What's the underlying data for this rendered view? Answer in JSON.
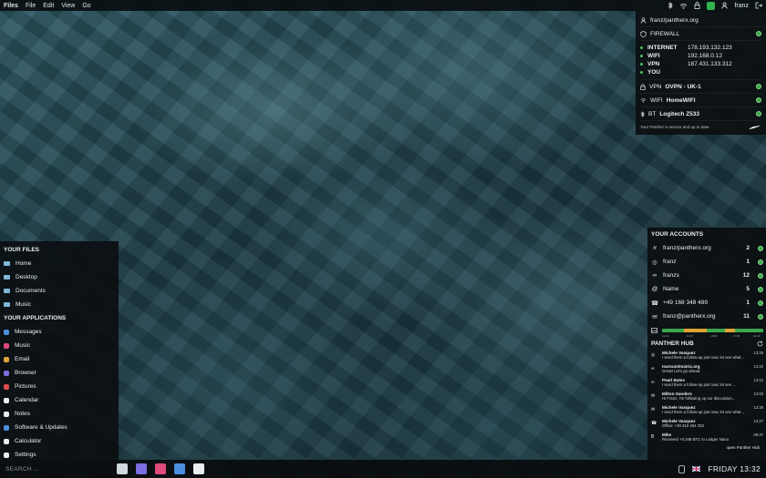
{
  "topbar": {
    "app_name": "Files",
    "menu": [
      "File",
      "Edit",
      "View",
      "Go"
    ],
    "user": "franz",
    "icons": [
      "bluetooth-icon",
      "wifi-icon",
      "lock-icon",
      "shield-badge-icon",
      "user-icon",
      "logout-icon"
    ]
  },
  "network": {
    "account": "franz/pantherx.org",
    "firewall_label": "FIREWALL",
    "ips": [
      {
        "label": "INTERNET",
        "value": "178.193.132.123"
      },
      {
        "label": "WIFI",
        "value": "192.168.0.12"
      },
      {
        "label": "VPN",
        "value": "187.431.133.312"
      },
      {
        "label": "YOU",
        "value": ""
      }
    ],
    "vpn": {
      "prefix": "VPN",
      "name": "OVPN - UK-1"
    },
    "wifi": {
      "prefix": "WIFI",
      "name": "HomeWIFI"
    },
    "bt": {
      "prefix": "BT",
      "name": "Logitech Z533"
    },
    "footer": "Your Panther is secure and up to date."
  },
  "files": {
    "title": "YOUR FILES",
    "items": [
      "Home",
      "Desktop",
      "Documents",
      "Music"
    ]
  },
  "applications": {
    "title": "YOUR APPLICATIONS",
    "items": [
      {
        "label": "Messages",
        "color": "#4a8fe0"
      },
      {
        "label": "Music",
        "color": "#e04a7a"
      },
      {
        "label": "Email",
        "color": "#e0a235"
      },
      {
        "label": "Browser",
        "color": "#7a6ee0"
      },
      {
        "label": "Pictures",
        "color": "#e04a4a"
      },
      {
        "label": "Calendar",
        "color": "#e8eef0"
      },
      {
        "label": "Notes",
        "color": "#e8eef0"
      },
      {
        "label": "Software & Updates",
        "color": "#4a8fe0"
      },
      {
        "label": "Calculator",
        "color": "#e8eef0"
      },
      {
        "label": "Settings",
        "color": "#e8eef0"
      }
    ]
  },
  "accounts": {
    "title": "YOUR ACCOUNTS",
    "items": [
      {
        "icon": "hash-icon",
        "label": "franz/pantherx.org",
        "count": "2"
      },
      {
        "icon": "chat-icon",
        "label": "franz",
        "count": "1"
      },
      {
        "icon": "link-icon",
        "label": "franzs",
        "count": "12"
      },
      {
        "icon": "at-icon",
        "label": "Name",
        "count": "5"
      },
      {
        "icon": "phone-icon",
        "label": "+49 168 348 489",
        "count": "1"
      },
      {
        "icon": "mail-icon",
        "label": "franz@pantherx.org",
        "count": "11"
      }
    ],
    "bar_ticks": [
      "12:32",
      "14:15",
      "16:00",
      "17:45",
      "19:32"
    ]
  },
  "hub": {
    "title": "PANTHER HUB",
    "messages": [
      {
        "icon": "chat-icon",
        "sender": "Michele Vasquez",
        "time": "13:25",
        "text": "I send them a follow-up just now, let see what..."
      },
      {
        "icon": "link-icon",
        "sender": "marsum/matrix.org",
        "time": "13:22",
        "text": "Great! Let's go ahead."
      },
      {
        "icon": "link-icon",
        "sender": "Pearl Bates",
        "time": "13:12",
        "text": "I send them a follow-up just now, let see ..."
      },
      {
        "icon": "mail-icon",
        "sender": "Milton Sanders",
        "time": "13:03",
        "text": "Hi Franz, I'm following up our discussion..."
      },
      {
        "icon": "mail-icon",
        "sender": "Michele Vasquez",
        "time": "12:38",
        "text": "I send them a follow-up just now, let see what..."
      },
      {
        "icon": "phone-icon",
        "sender": "Michele Vasquez",
        "time": "12:27",
        "text": "Office: +49 310 464 333"
      },
      {
        "icon": "bitcoin-icon",
        "sender": "Mike",
        "time": "09:37",
        "text": "Received +0.348 BTC to Ledger Nano"
      }
    ],
    "footer_link": "open Panther Hub"
  },
  "dock": {
    "search_placeholder": "SEARCH ...",
    "apps": [
      {
        "name": "files-icon",
        "color": "#cfd8dc"
      },
      {
        "name": "browser-icon",
        "color": "#7a6ee0"
      },
      {
        "name": "music-icon",
        "color": "#e04a7a"
      },
      {
        "name": "messages-icon",
        "color": "#4a8fe0"
      },
      {
        "name": "settings-icon",
        "color": "#e8eef0"
      }
    ],
    "clock": "FRIDAY 13:32"
  }
}
